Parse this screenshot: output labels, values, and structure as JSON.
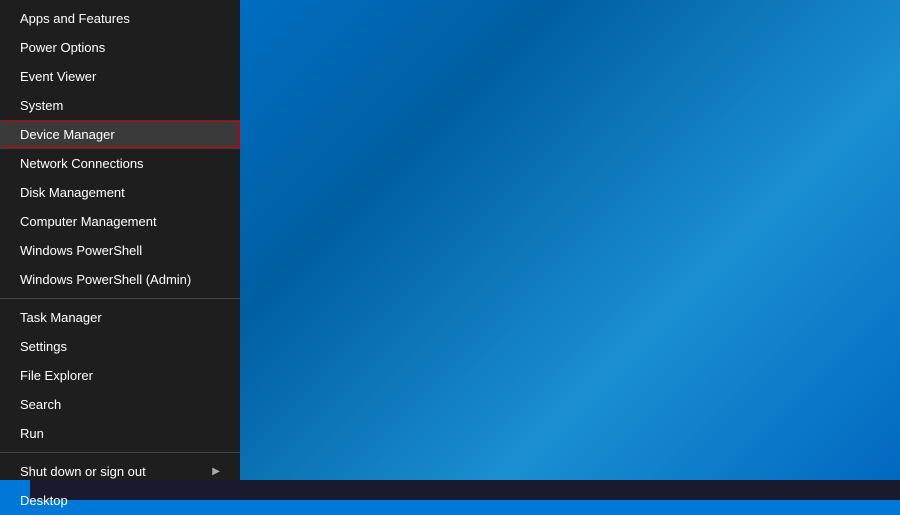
{
  "desktop": {
    "background": "blue gradient"
  },
  "contextMenu": {
    "items": [
      {
        "id": "apps-features",
        "label": "Apps and Features",
        "type": "item",
        "highlighted": false
      },
      {
        "id": "power-options",
        "label": "Power Options",
        "type": "item",
        "highlighted": false
      },
      {
        "id": "event-viewer",
        "label": "Event Viewer",
        "type": "item",
        "highlighted": false
      },
      {
        "id": "system",
        "label": "System",
        "type": "item",
        "highlighted": false
      },
      {
        "id": "device-manager",
        "label": "Device Manager",
        "type": "item",
        "highlighted": true
      },
      {
        "id": "network-connections",
        "label": "Network Connections",
        "type": "item",
        "highlighted": false
      },
      {
        "id": "disk-management",
        "label": "Disk Management",
        "type": "item",
        "highlighted": false
      },
      {
        "id": "computer-management",
        "label": "Computer Management",
        "type": "item",
        "highlighted": false
      },
      {
        "id": "windows-powershell",
        "label": "Windows PowerShell",
        "type": "item",
        "highlighted": false
      },
      {
        "id": "windows-powershell-admin",
        "label": "Windows PowerShell (Admin)",
        "type": "item",
        "highlighted": false
      },
      {
        "id": "sep1",
        "type": "separator"
      },
      {
        "id": "task-manager",
        "label": "Task Manager",
        "type": "item",
        "highlighted": false
      },
      {
        "id": "settings",
        "label": "Settings",
        "type": "item",
        "highlighted": false
      },
      {
        "id": "file-explorer",
        "label": "File Explorer",
        "type": "item",
        "highlighted": false
      },
      {
        "id": "search",
        "label": "Search",
        "type": "item",
        "highlighted": false
      },
      {
        "id": "run",
        "label": "Run",
        "type": "item",
        "highlighted": false
      },
      {
        "id": "sep2",
        "type": "separator"
      },
      {
        "id": "shut-down-sign-out",
        "label": "Shut down or sign out",
        "type": "item-arrow",
        "highlighted": false
      },
      {
        "id": "desktop",
        "label": "Desktop",
        "type": "item",
        "highlighted": false
      }
    ]
  }
}
